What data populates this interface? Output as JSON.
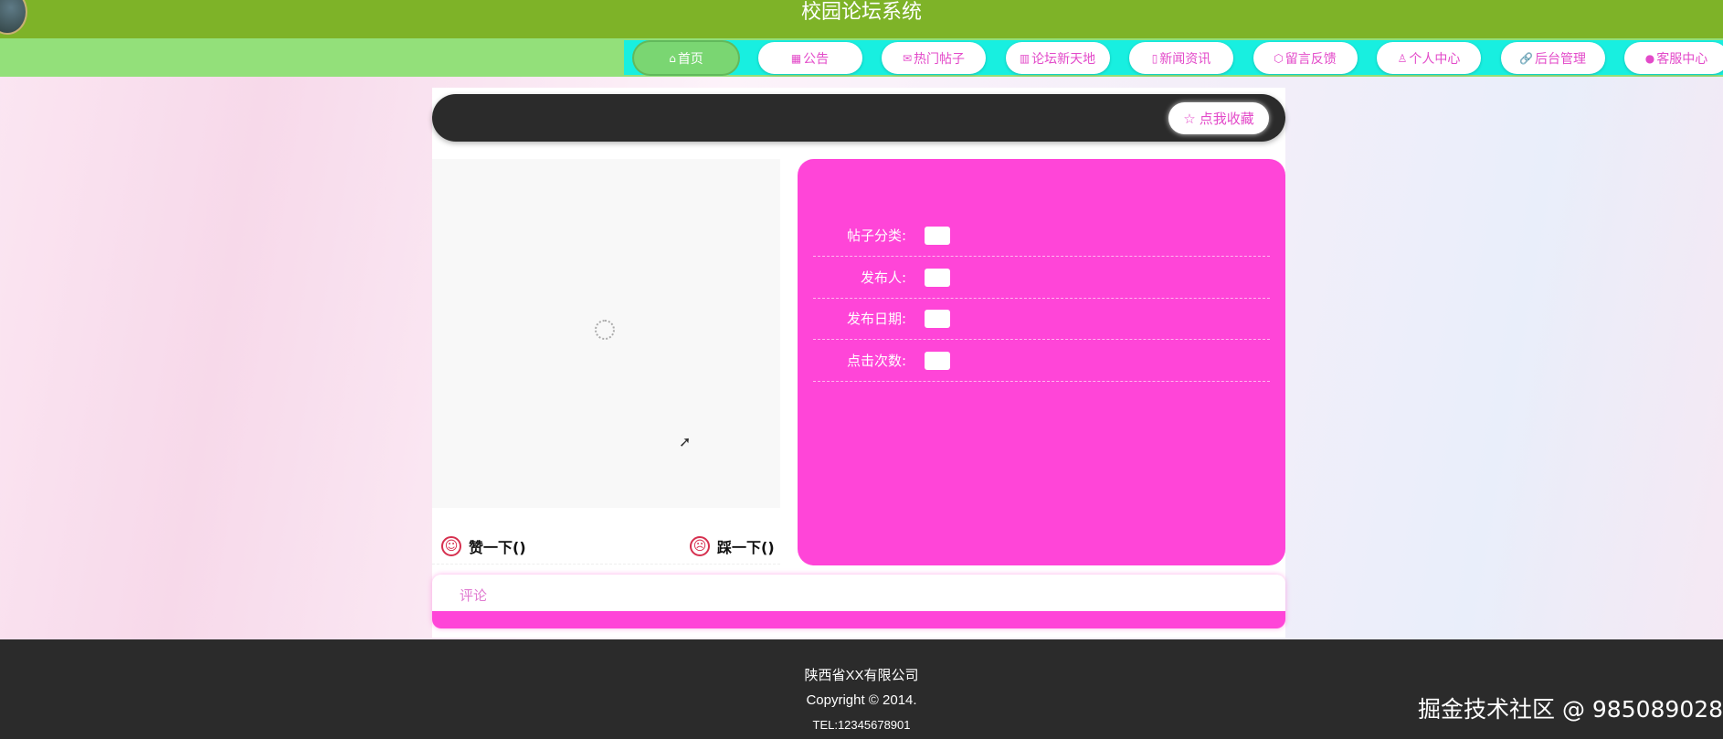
{
  "header": {
    "title": "校园论坛系统"
  },
  "nav": [
    {
      "label": "首页",
      "icon": "home-icon",
      "glyph": "⌂",
      "active": true
    },
    {
      "label": "公告",
      "icon": "notice-icon",
      "glyph": "▦"
    },
    {
      "label": "热门帖子",
      "icon": "mail-icon",
      "glyph": "✉"
    },
    {
      "label": "论坛新天地",
      "icon": "grid-icon",
      "glyph": "▥"
    },
    {
      "label": "新闻资讯",
      "icon": "news-icon",
      "glyph": "▯"
    },
    {
      "label": "留言反馈",
      "icon": "cube-icon",
      "glyph": "⬡"
    },
    {
      "label": "个人中心",
      "icon": "user-icon",
      "glyph": "♙"
    },
    {
      "label": "后台管理",
      "icon": "link-icon",
      "glyph": "🔗"
    },
    {
      "label": "客服中心",
      "icon": "chat-icon",
      "glyph": "●"
    }
  ],
  "detail": {
    "favorite_label": "点我收藏",
    "fields": [
      {
        "label": "帖子分类:"
      },
      {
        "label": "发布人:"
      },
      {
        "label": "发布日期:"
      },
      {
        "label": "点击次数:"
      }
    ],
    "like_label": "赞一下()",
    "dislike_label": "踩一下()"
  },
  "comment": {
    "label": "评论"
  },
  "footer": {
    "company": "陕西省XX有限公司",
    "copyright": "Copyright © 2014.",
    "tel": "TEL:12345678901"
  },
  "watermark": "掘金技术社区 @ 985089028",
  "colors": {
    "header": "#7eb328",
    "nav": "#93e07a",
    "nav_strip": "#18efe0",
    "accent": "#ff45d8",
    "dark": "#2b2b2b"
  }
}
